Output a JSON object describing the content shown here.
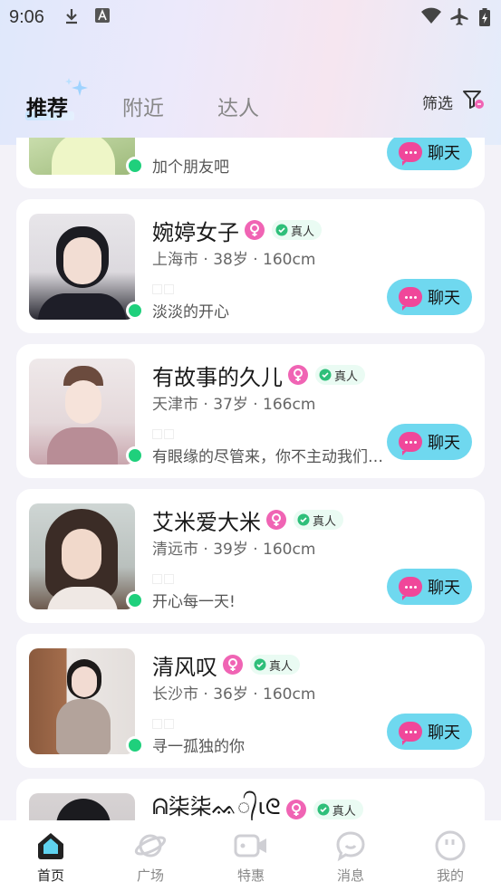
{
  "status_bar": {
    "time": "9:06"
  },
  "tabs": [
    {
      "label": "推荐",
      "active": true
    },
    {
      "label": "附近",
      "active": false
    },
    {
      "label": "达人",
      "active": false
    }
  ],
  "filter_label": "筛选",
  "colors": {
    "accent": "#6fd8ef",
    "online": "#1fd07c",
    "gender": "#f064b4",
    "chat_icon": "#f0479a"
  },
  "users": [
    {
      "name": "",
      "meta": "",
      "bio": "加个朋友吧",
      "chat_label": "聊天",
      "verified_label": ""
    },
    {
      "name": "婉婷女子",
      "meta": "上海市 · 38岁 · 160cm",
      "bio": "淡淡的开心",
      "chat_label": "聊天",
      "verified_label": "真人"
    },
    {
      "name": "有故事的久儿",
      "meta": "天津市 · 37岁 · 166cm",
      "bio": "有眼缘的尽管来，你不主动我们怎么会有故事",
      "chat_label": "聊天",
      "verified_label": "真人"
    },
    {
      "name": "艾米爱大米",
      "meta": "清远市 · 39岁 · 160cm",
      "bio": "开心每一天!",
      "chat_label": "聊天",
      "verified_label": "真人"
    },
    {
      "name": "清风叹",
      "meta": "长沙市 · 36岁 · 160cm",
      "bio": "寻一孤独的你",
      "chat_label": "聊天",
      "verified_label": "真人"
    },
    {
      "name": "ᕱ柒柒ᨐ᭄ɩᘓ",
      "meta": "",
      "bio": "",
      "chat_label": "",
      "verified_label": "真人"
    }
  ],
  "bottom_nav": [
    {
      "label": "首页",
      "icon": "home-icon",
      "active": true
    },
    {
      "label": "广场",
      "icon": "planet-icon",
      "active": false
    },
    {
      "label": "特惠",
      "icon": "video-icon",
      "active": false
    },
    {
      "label": "消息",
      "icon": "message-icon",
      "active": false
    },
    {
      "label": "我的",
      "icon": "profile-icon",
      "active": false
    }
  ]
}
